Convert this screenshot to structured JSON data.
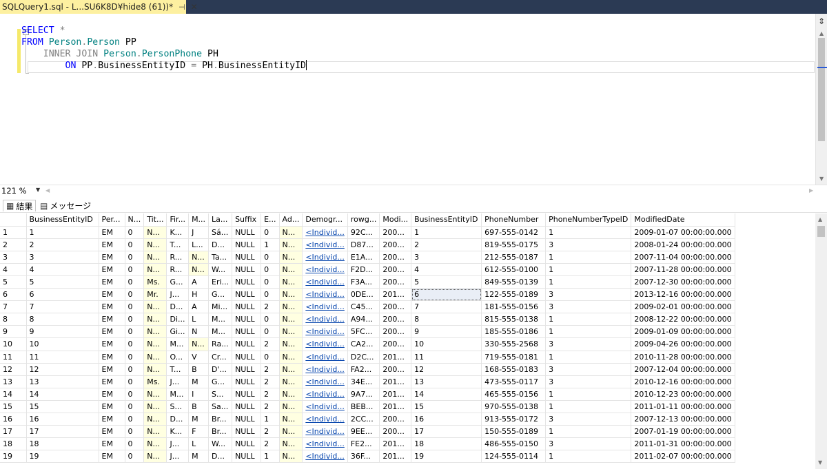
{
  "window": {
    "tab_title": "SQLQuery1.sql - L...SU6K8D¥hide8 (61))*",
    "pin_glyph": "⊣",
    "close_glyph": "✕"
  },
  "editor": {
    "lines": [
      [
        {
          "t": "SELECT",
          "c": "kw"
        },
        {
          "t": " ",
          "c": ""
        },
        {
          "t": "*",
          "c": "gray"
        }
      ],
      [
        {
          "t": "FROM",
          "c": "kw"
        },
        {
          "t": " ",
          "c": ""
        },
        {
          "t": "Person",
          "c": "obj"
        },
        {
          "t": ".",
          "c": "gray"
        },
        {
          "t": "Person",
          "c": "obj"
        },
        {
          "t": " PP",
          "c": ""
        }
      ],
      [
        {
          "t": "    ",
          "c": ""
        },
        {
          "t": "INNER JOIN",
          "c": "gray"
        },
        {
          "t": " ",
          "c": ""
        },
        {
          "t": "Person",
          "c": "obj"
        },
        {
          "t": ".",
          "c": "gray"
        },
        {
          "t": "PersonPhone",
          "c": "obj"
        },
        {
          "t": " PH",
          "c": ""
        }
      ],
      [
        {
          "t": "        ",
          "c": ""
        },
        {
          "t": "ON",
          "c": "kw"
        },
        {
          "t": " PP",
          "c": ""
        },
        {
          "t": ".",
          "c": "gray"
        },
        {
          "t": "BusinessEntityID ",
          "c": ""
        },
        {
          "t": "=",
          "c": "gray"
        },
        {
          "t": " PH",
          "c": ""
        },
        {
          "t": ".",
          "c": "gray"
        },
        {
          "t": "BusinessEntityID",
          "c": ""
        }
      ]
    ]
  },
  "zoom": {
    "value": "121 %"
  },
  "results_tabs": {
    "results_label": "結果",
    "messages_label": "メッセージ"
  },
  "grid": {
    "headers": [
      "",
      "BusinessEntityID",
      "Per...",
      "N...",
      "Tit...",
      "Fir...",
      "M...",
      "La...",
      "Suffix",
      "E...",
      "Ad...",
      "Demogr...",
      "rowg...",
      "Modi...",
      "BusinessEntityID",
      "PhoneNumber",
      "PhoneNumberTypeID",
      "ModifiedDate"
    ],
    "rows": [
      [
        "1",
        "1",
        "EM",
        "0",
        "N...",
        "K...",
        "J",
        "Sá...",
        "NULL",
        "0",
        "N...",
        "<Individ...",
        "92C...",
        "200...",
        "1",
        "697-555-0142",
        "1",
        "2009-01-07 00:00:00.000"
      ],
      [
        "2",
        "2",
        "EM",
        "0",
        "N...",
        "T...",
        "L...",
        "D...",
        "NULL",
        "1",
        "N...",
        "<Individ...",
        "D87...",
        "200...",
        "2",
        "819-555-0175",
        "3",
        "2008-01-24 00:00:00.000"
      ],
      [
        "3",
        "3",
        "EM",
        "0",
        "N...",
        "R...",
        "N...",
        "Ta...",
        "NULL",
        "0",
        "N...",
        "<Individ...",
        "E1A...",
        "200...",
        "3",
        "212-555-0187",
        "1",
        "2007-11-04 00:00:00.000"
      ],
      [
        "4",
        "4",
        "EM",
        "0",
        "N...",
        "R...",
        "N...",
        "W...",
        "NULL",
        "0",
        "N...",
        "<Individ...",
        "F2D...",
        "200...",
        "4",
        "612-555-0100",
        "1",
        "2007-11-28 00:00:00.000"
      ],
      [
        "5",
        "5",
        "EM",
        "0",
        "Ms.",
        "G...",
        "A",
        "Eri...",
        "NULL",
        "0",
        "N...",
        "<Individ...",
        "F3A...",
        "200...",
        "5",
        "849-555-0139",
        "1",
        "2007-12-30 00:00:00.000"
      ],
      [
        "6",
        "6",
        "EM",
        "0",
        "Mr.",
        "J...",
        "H",
        "G...",
        "NULL",
        "0",
        "N...",
        "<Individ...",
        "0DE...",
        "201...",
        "6",
        "122-555-0189",
        "3",
        "2013-12-16 00:00:00.000"
      ],
      [
        "7",
        "7",
        "EM",
        "0",
        "N...",
        "D...",
        "A",
        "Mi...",
        "NULL",
        "2",
        "N...",
        "<Individ...",
        "C45...",
        "200...",
        "7",
        "181-555-0156",
        "3",
        "2009-02-01 00:00:00.000"
      ],
      [
        "8",
        "8",
        "EM",
        "0",
        "N...",
        "Di...",
        "L",
        "M...",
        "NULL",
        "0",
        "N...",
        "<Individ...",
        "A94...",
        "200...",
        "8",
        "815-555-0138",
        "1",
        "2008-12-22 00:00:00.000"
      ],
      [
        "9",
        "9",
        "EM",
        "0",
        "N...",
        "Gi...",
        "N",
        "M...",
        "NULL",
        "0",
        "N...",
        "<Individ...",
        "5FC...",
        "200...",
        "9",
        "185-555-0186",
        "1",
        "2009-01-09 00:00:00.000"
      ],
      [
        "10",
        "10",
        "EM",
        "0",
        "N...",
        "M...",
        "N...",
        "Ra...",
        "NULL",
        "2",
        "N...",
        "<Individ...",
        "CA2...",
        "200...",
        "10",
        "330-555-2568",
        "3",
        "2009-04-26 00:00:00.000"
      ],
      [
        "11",
        "11",
        "EM",
        "0",
        "N...",
        "O...",
        "V",
        "Cr...",
        "NULL",
        "0",
        "N...",
        "<Individ...",
        "D2C...",
        "201...",
        "11",
        "719-555-0181",
        "1",
        "2010-11-28 00:00:00.000"
      ],
      [
        "12",
        "12",
        "EM",
        "0",
        "N...",
        "T...",
        "B",
        "D'...",
        "NULL",
        "2",
        "N...",
        "<Individ...",
        "FA2...",
        "200...",
        "12",
        "168-555-0183",
        "3",
        "2007-12-04 00:00:00.000"
      ],
      [
        "13",
        "13",
        "EM",
        "0",
        "Ms.",
        "J...",
        "M",
        "G...",
        "NULL",
        "2",
        "N...",
        "<Individ...",
        "34E...",
        "201...",
        "13",
        "473-555-0117",
        "3",
        "2010-12-16 00:00:00.000"
      ],
      [
        "14",
        "14",
        "EM",
        "0",
        "N...",
        "M...",
        "I",
        "S...",
        "NULL",
        "2",
        "N...",
        "<Individ...",
        "9A7...",
        "201...",
        "14",
        "465-555-0156",
        "1",
        "2010-12-23 00:00:00.000"
      ],
      [
        "15",
        "15",
        "EM",
        "0",
        "N...",
        "S...",
        "B",
        "Sa...",
        "NULL",
        "2",
        "N...",
        "<Individ...",
        "BEB...",
        "201...",
        "15",
        "970-555-0138",
        "1",
        "2011-01-11 00:00:00.000"
      ],
      [
        "16",
        "16",
        "EM",
        "0",
        "N...",
        "D...",
        "M",
        "Br...",
        "NULL",
        "1",
        "N...",
        "<Individ...",
        "2CC...",
        "200...",
        "16",
        "913-555-0172",
        "3",
        "2007-12-13 00:00:00.000"
      ],
      [
        "17",
        "17",
        "EM",
        "0",
        "N...",
        "K...",
        "F",
        "Br...",
        "NULL",
        "2",
        "N...",
        "<Individ...",
        "9EE...",
        "200...",
        "17",
        "150-555-0189",
        "1",
        "2007-01-19 00:00:00.000"
      ],
      [
        "18",
        "18",
        "EM",
        "0",
        "N...",
        "J...",
        "L",
        "W...",
        "NULL",
        "2",
        "N...",
        "<Individ...",
        "FE2...",
        "201...",
        "18",
        "486-555-0150",
        "3",
        "2011-01-31 00:00:00.000"
      ],
      [
        "19",
        "19",
        "EM",
        "0",
        "N...",
        "J...",
        "M",
        "D...",
        "NULL",
        "1",
        "N...",
        "<Individ...",
        "36F...",
        "201...",
        "19",
        "124-555-0114",
        "1",
        "2011-02-07 00:00:00.000"
      ]
    ],
    "selected": {
      "row": 5,
      "col": 14
    }
  }
}
